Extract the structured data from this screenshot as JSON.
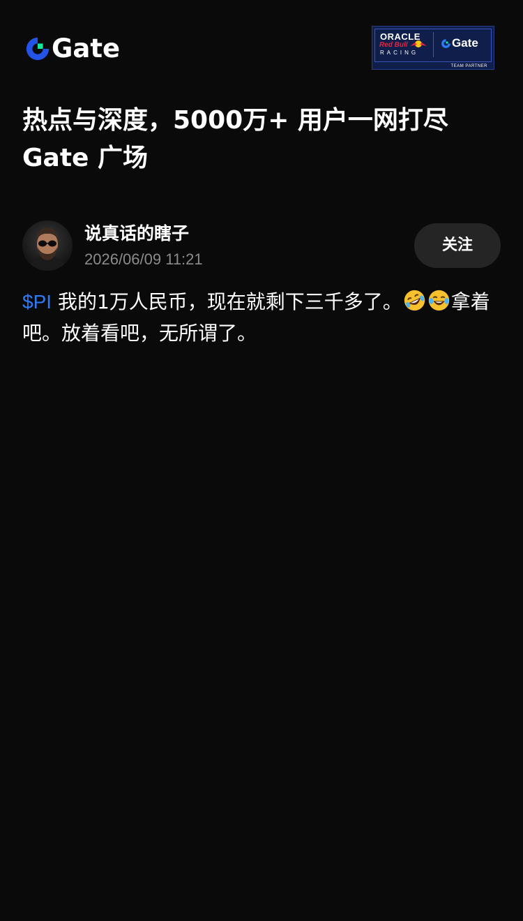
{
  "header": {
    "logo_text": "Gate",
    "partner": {
      "oracle": "ORACLE",
      "red_bull": "Red Bull",
      "racing": "RACING",
      "gate": "Gate",
      "team": "TEAM PARTNER"
    }
  },
  "headline": {
    "line1": "热点与深度，5000万+ 用户一网打尽",
    "line2": "Gate 广场"
  },
  "post": {
    "author": "说真话的瞎子",
    "timestamp": "2026/06/09 11:21",
    "follow_label": "关注",
    "ticker": "$PI",
    "text_part1": "我的1万人民币，现在就剩下三千多了。",
    "text_part2": "拿着吧。放着看吧，无所谓了。",
    "emojis": [
      "rolling-on-floor-laughing-emoji",
      "tears-of-joy-emoji"
    ]
  },
  "colors": {
    "background": "#0a0a0a",
    "ticker": "#2f7bf5",
    "follow_button_bg": "#252525",
    "timestamp": "#8b8b8b",
    "brand_blue": "#2354e6",
    "brand_green": "#17e6a1"
  }
}
